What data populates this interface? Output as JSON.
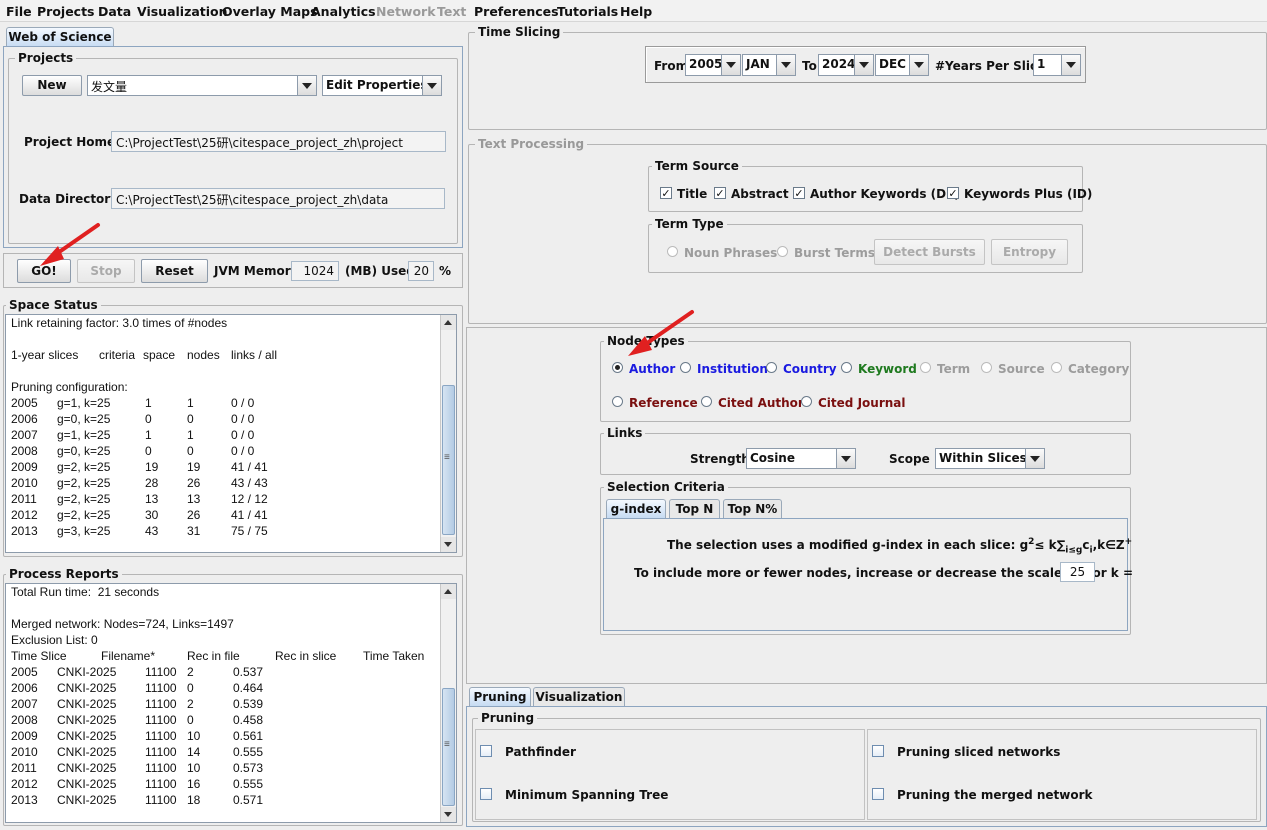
{
  "menu": [
    "File",
    "Projects",
    "Data",
    "Visualization",
    "Overlay Maps",
    "Analytics",
    "Network",
    "Text",
    "Preferences",
    "Tutorials",
    "Help"
  ],
  "left": {
    "top_tab": "Web of Science",
    "projects_title": "Projects",
    "new_label": "New",
    "project_name": "发文量",
    "edit_properties": "Edit Properties",
    "project_home_label": "Project Home:",
    "project_home": "C:\\ProjectTest\\25研\\citespace_project_zh\\project",
    "data_dir_label": "Data Directory:",
    "data_dir": "C:\\ProjectTest\\25研\\citespace_project_zh\\data",
    "go_label": "GO!",
    "stop_label": "Stop",
    "reset_label": "Reset",
    "jvm_label": "JVM Memory",
    "jvm_value": "1024",
    "mb_used_label": "(MB) Used",
    "used_value": "20",
    "percent": "%"
  },
  "space_status": {
    "title": "Space Status",
    "line1": "Link retaining factor: 3.0 times of #nodes",
    "header": [
      "1-year slices",
      "criteria",
      "space",
      "nodes",
      "links / all"
    ],
    "pruning": "Pruning configuration:",
    "rows": [
      [
        "2005",
        "g=1, k=25",
        "1",
        "1",
        "0 / 0"
      ],
      [
        "2006",
        "g=0, k=25",
        "0",
        "0",
        "0 / 0"
      ],
      [
        "2007",
        "g=1, k=25",
        "1",
        "1",
        "0 / 0"
      ],
      [
        "2008",
        "g=0, k=25",
        "0",
        "0",
        "0 / 0"
      ],
      [
        "2009",
        "g=2, k=25",
        "19",
        "19",
        "41 / 41"
      ],
      [
        "2010",
        "g=2, k=25",
        "28",
        "26",
        "43 / 43"
      ],
      [
        "2011",
        "g=2, k=25",
        "13",
        "13",
        "12 / 12"
      ],
      [
        "2012",
        "g=2, k=25",
        "30",
        "26",
        "41 / 41"
      ],
      [
        "2013",
        "g=3, k=25",
        "43",
        "31",
        "75 / 75"
      ]
    ]
  },
  "process_reports": {
    "title": "Process Reports",
    "runtime": "Total Run time:  21 seconds",
    "merged": "Merged network: Nodes=724, Links=1497",
    "exclusion": "Exclusion List: 0",
    "header": [
      "Time Slice",
      "Filename*",
      "Rec in file",
      "Rec in slice",
      "Time Taken"
    ],
    "rows": [
      [
        "2005",
        "CNKI-2025",
        "11100",
        "2",
        "0.537"
      ],
      [
        "2006",
        "CNKI-2025",
        "11100",
        "0",
        "0.464"
      ],
      [
        "2007",
        "CNKI-2025",
        "11100",
        "2",
        "0.539"
      ],
      [
        "2008",
        "CNKI-2025",
        "11100",
        "0",
        "0.458"
      ],
      [
        "2009",
        "CNKI-2025",
        "11100",
        "10",
        "0.561"
      ],
      [
        "2010",
        "CNKI-2025",
        "11100",
        "14",
        "0.555"
      ],
      [
        "2011",
        "CNKI-2025",
        "11100",
        "10",
        "0.573"
      ],
      [
        "2012",
        "CNKI-2025",
        "11100",
        "16",
        "0.555"
      ],
      [
        "2013",
        "CNKI-2025",
        "11100",
        "18",
        "0.571"
      ]
    ]
  },
  "time_slicing": {
    "title": "Time Slicing",
    "from": "From",
    "from_year": "2005",
    "from_month": "JAN",
    "to": "To",
    "to_year": "2024",
    "to_month": "DEC",
    "years_per_slice": "#Years Per Slice",
    "slice_value": "1"
  },
  "text_processing": {
    "title": "Text Processing",
    "term_source": "Term Source",
    "sources": [
      "Title",
      "Abstract",
      "Author Keywords (DE)",
      "Keywords Plus (ID)"
    ],
    "term_type": "Term Type",
    "noun_phrases": "Noun Phrases",
    "burst_terms": "Burst Terms",
    "detect_bursts": "Detect Bursts",
    "entropy": "Entropy"
  },
  "node_types": {
    "title": "Node Types",
    "row1": [
      "Author",
      "Institution",
      "Country",
      "Keyword",
      "Term",
      "Source",
      "Category"
    ],
    "row2": [
      "Reference",
      "Cited Author",
      "Cited Journal"
    ],
    "selected": "Author"
  },
  "links": {
    "title": "Links",
    "strength_label": "Strength",
    "strength": "Cosine",
    "scope_label": "Scope",
    "scope": "Within Slices"
  },
  "selection": {
    "title": "Selection Criteria",
    "tabs": [
      "g-index",
      "Top N",
      "Top N%"
    ],
    "formula_text": "The selection uses a modified g-index in each slice: ",
    "formula_g": "g",
    "formula_sup": "2",
    "formula_mid": "≤ k",
    "formula_sum": "∑",
    "formula_sub": "i≤g",
    "formula_c": "c",
    "formula_ci": "i",
    "formula_end": ",k∈Z",
    "formula_plus": "+",
    "scale_text": "To include more or fewer nodes, increase or decrease the scale factor k =",
    "k_value": "25"
  },
  "bottom": {
    "tabs": [
      "Pruning",
      "Visualization"
    ],
    "pruning_title": "Pruning",
    "left_opts": [
      "Pathfinder",
      "Minimum Spanning Tree"
    ],
    "right_opts": [
      "Pruning sliced networks",
      "Pruning the merged network"
    ]
  },
  "colors": {
    "author": "#1a1ae0",
    "keyword": "#1f7a1f",
    "reference": "#7a0f0f",
    "arrow": "#e02020"
  }
}
